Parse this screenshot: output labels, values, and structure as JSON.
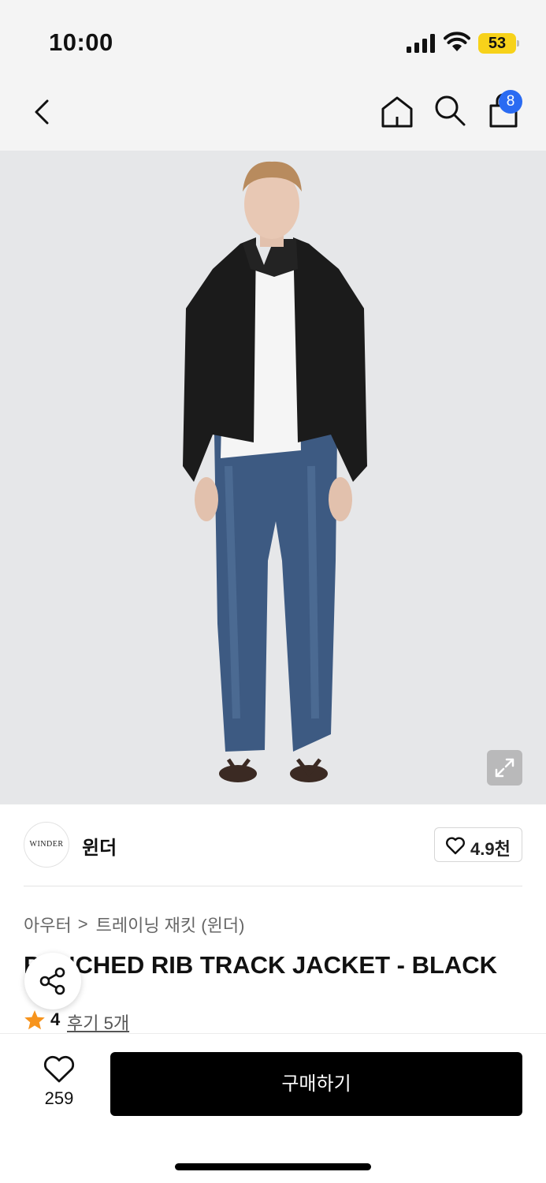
{
  "status_bar": {
    "time": "10:00",
    "battery": "53",
    "icons": [
      "signal-icon",
      "wifi-icon",
      "battery-icon"
    ]
  },
  "nav": {
    "icons": [
      "back-arrow-icon",
      "home-icon",
      "search-icon",
      "shopping-bag-icon"
    ],
    "cart_badge": "8"
  },
  "product_image": {
    "icon": "expand-icon"
  },
  "brand": {
    "logo_text": "WINDER",
    "name": "윈더",
    "like_count": "4.9천"
  },
  "product": {
    "breadcrumb": [
      "아우터",
      "트레이닝 재킷 (윈더)"
    ],
    "breadcrumb_separator": ">",
    "title": "PUNCHED RIB TRACK JACKET - BLACK",
    "rating": "4",
    "reviews_label": "후기 5개"
  },
  "bottom_bar": {
    "wish_count": "259",
    "buy_label": "구매하기"
  },
  "colors": {
    "header_bg": "#f4f4f4",
    "badge_blue": "#2a6bf2",
    "battery_yellow": "#f7d21a",
    "star_orange": "#f7941d",
    "buy_button": "#000000",
    "image_bg": "#e6e7e9"
  }
}
